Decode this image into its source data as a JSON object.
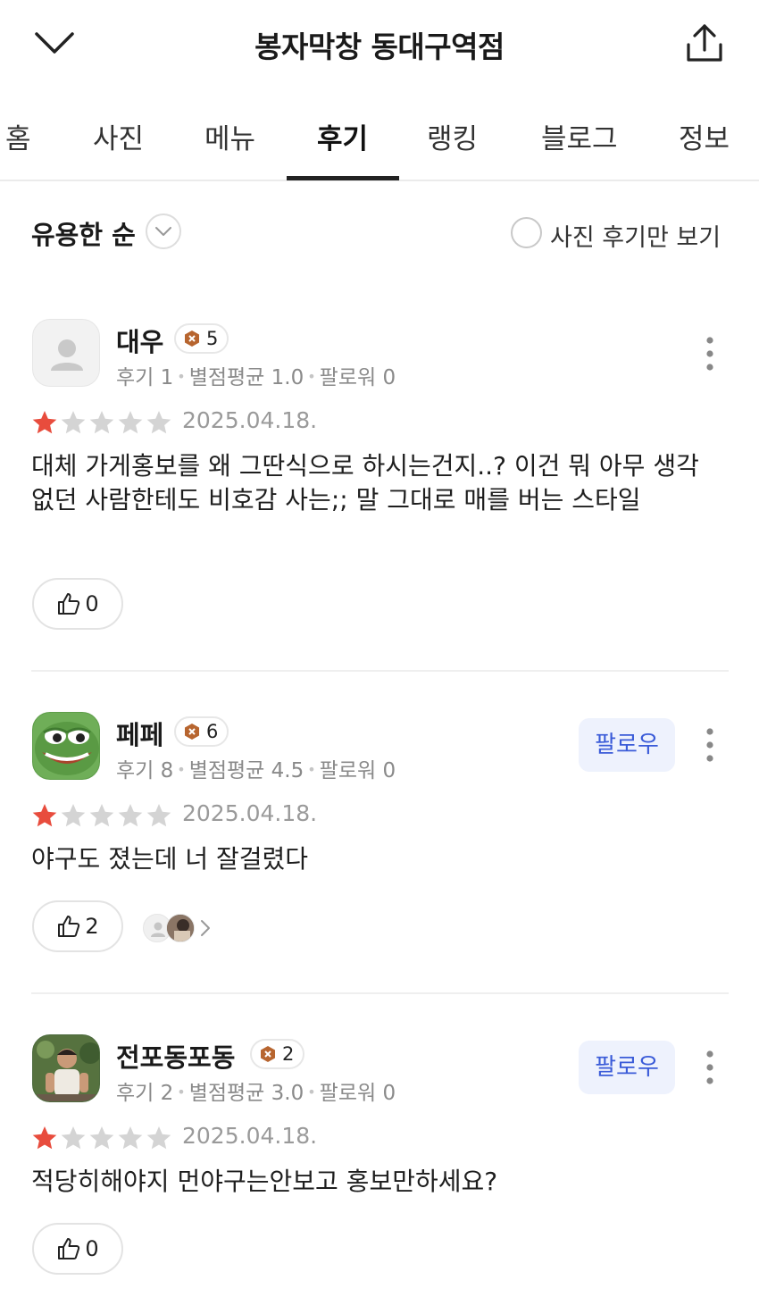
{
  "header": {
    "title": "봉자막창 동대구역점",
    "back_icon": "chevron-down-icon",
    "share_icon": "share-icon"
  },
  "tabs": [
    {
      "label": "홈"
    },
    {
      "label": "사진"
    },
    {
      "label": "메뉴"
    },
    {
      "label": "후기",
      "active": true
    },
    {
      "label": "랭킹"
    },
    {
      "label": "블로그"
    },
    {
      "label": "정보"
    }
  ],
  "sort": {
    "label": "유용한 순",
    "photo_only_label": "사진 후기만 보기"
  },
  "colors": {
    "star_filled": "#e84c3d",
    "star_empty": "#d4d4d4",
    "follow_text": "#3a5bd8",
    "follow_bg": "#eef2fd",
    "badge": "#b7652f"
  },
  "reviews": [
    {
      "username": "대우",
      "level": "5",
      "stats": {
        "reviews": "후기 1",
        "avg": "별점평균 1.0",
        "followers": "팔로워 0"
      },
      "rating": 1,
      "date": "2025.04.18.",
      "text": "대체 가게홍보를 왜 그딴식으로 하시는건지..? 이건 뭐 아무 생각없던 사람한테도 비호감 사는;; 말 그대로 매를 버는 스타일",
      "likes": "0",
      "show_follow": false
    },
    {
      "username": "페페",
      "level": "6",
      "stats": {
        "reviews": "후기 8",
        "avg": "별점평균 4.5",
        "followers": "팔로워 0"
      },
      "rating": 1,
      "date": "2025.04.18.",
      "text": "야구도 졌는데 너 잘걸렸다",
      "likes": "2",
      "show_follow": true,
      "follow_label": "팔로우"
    },
    {
      "username": "전포동포동",
      "level": "2",
      "stats": {
        "reviews": "후기 2",
        "avg": "별점평균 3.0",
        "followers": "팔로워 0"
      },
      "rating": 1,
      "date": "2025.04.18.",
      "text": "적당히해야지 먼야구는안보고 홍보만하세요?",
      "likes": "0",
      "show_follow": true,
      "follow_label": "팔로우"
    }
  ]
}
